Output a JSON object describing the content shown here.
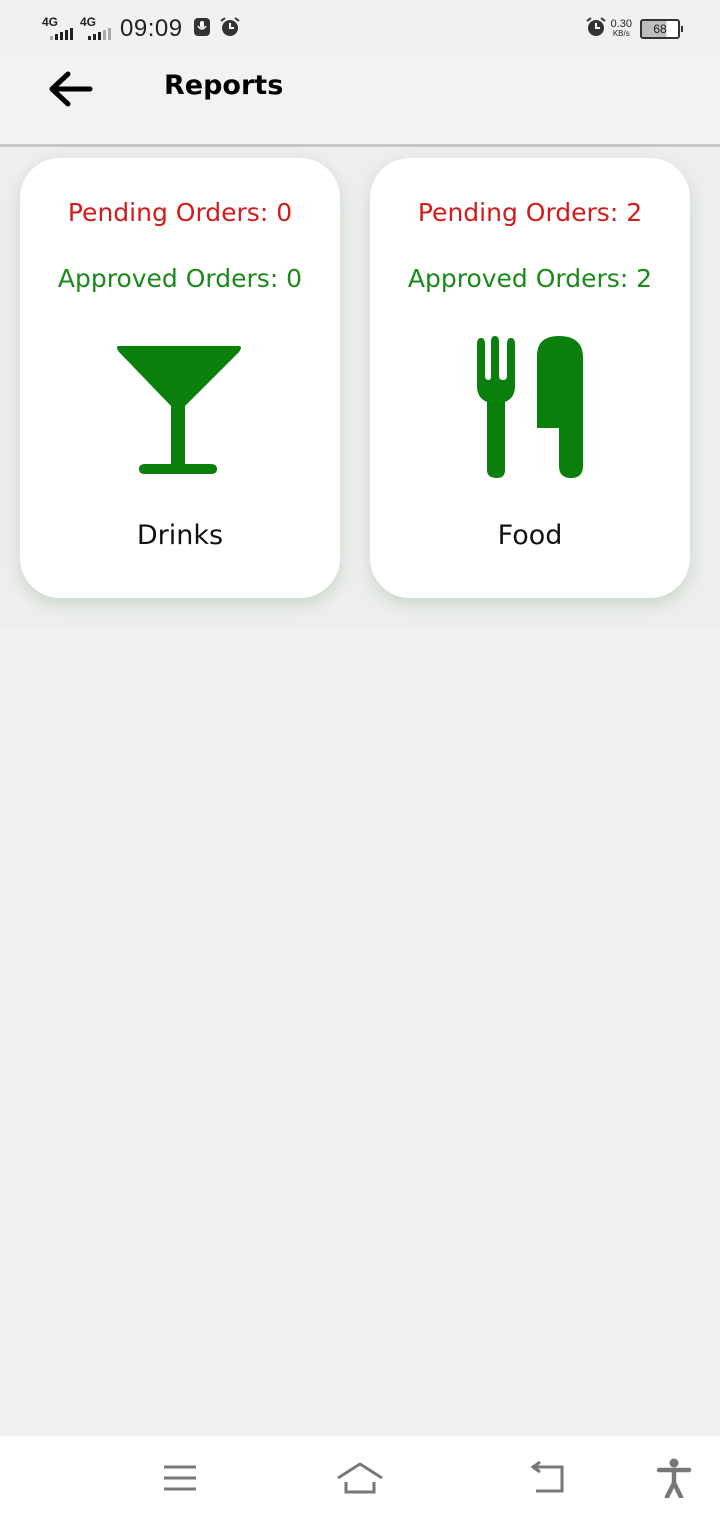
{
  "status_bar": {
    "network_1": "4G",
    "network_2": "4G",
    "time": "09:09",
    "speed_value": "0.30",
    "speed_unit": "KB/s",
    "battery": "68"
  },
  "header": {
    "title": "Reports"
  },
  "cards": [
    {
      "pending": "Pending Orders: 0",
      "approved": "Approved Orders: 0",
      "icon": "cocktail-glass-icon",
      "label": "Drinks"
    },
    {
      "pending": "Pending Orders: 2",
      "approved": "Approved Orders: 2",
      "icon": "fork-knife-icon",
      "label": "Food"
    }
  ],
  "colors": {
    "pending": "#d21b1b",
    "approved": "#1a8a1a",
    "icon": "#0b7f0b",
    "background": "#f1f1f1"
  },
  "nav": {
    "icons": [
      "menu-icon",
      "home-icon",
      "back-icon",
      "accessibility-icon"
    ]
  }
}
